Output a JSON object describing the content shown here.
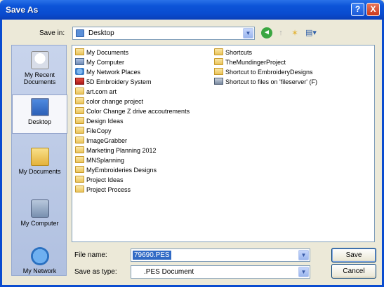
{
  "window": {
    "title": "Save As",
    "help_label": "?",
    "close_label": "X"
  },
  "toolbar": {
    "save_in_label": "Save in:",
    "save_in_value": "Desktop",
    "back_glyph": "◄",
    "up_glyph": "↑",
    "new_folder_glyph": "✶",
    "views_glyph": "▤▾",
    "dropdown_glyph": "▼"
  },
  "places": [
    {
      "label": "My Recent Documents",
      "icon": "recent-documents-icon"
    },
    {
      "label": "Desktop",
      "icon": "desktop-icon"
    },
    {
      "label": "My Documents",
      "icon": "my-documents-icon"
    },
    {
      "label": "My Computer",
      "icon": "my-computer-icon"
    },
    {
      "label": "My Network",
      "icon": "my-network-icon"
    }
  ],
  "files_col1": [
    {
      "label": "My Documents",
      "icon": "my-documents-icon"
    },
    {
      "label": "My Computer",
      "icon": "my-computer-icon"
    },
    {
      "label": "My Network Places",
      "icon": "network-icon"
    },
    {
      "label": "5D Embroidery System",
      "icon": "app-icon"
    },
    {
      "label": "art.com art",
      "icon": "folder-icon"
    },
    {
      "label": "color change project",
      "icon": "folder-icon"
    },
    {
      "label": "Color Change Z drive accoutrements",
      "icon": "folder-icon"
    },
    {
      "label": "Design Ideas",
      "icon": "folder-icon"
    },
    {
      "label": "FileCopy",
      "icon": "folder-icon"
    },
    {
      "label": "ImageGrabber",
      "icon": "folder-icon"
    },
    {
      "label": "Marketing Planning 2012",
      "icon": "folder-icon"
    },
    {
      "label": "MNSplanning",
      "icon": "folder-icon"
    },
    {
      "label": "MyEmbroideries Designs",
      "icon": "folder-icon"
    },
    {
      "label": "Project Ideas",
      "icon": "folder-icon"
    },
    {
      "label": "Project Process",
      "icon": "folder-icon"
    }
  ],
  "files_col2": [
    {
      "label": "Shortcuts",
      "icon": "folder-icon"
    },
    {
      "label": "TheMundingerProject",
      "icon": "folder-icon"
    },
    {
      "label": "Shortcut to EmbroideryDesigns",
      "icon": "shortcut-folder-icon"
    },
    {
      "label": "Shortcut to files on 'fileserver' (F)",
      "icon": "network-drive-icon"
    }
  ],
  "bottom": {
    "file_name_label": "File name:",
    "file_name_value": "79690.PES",
    "save_as_type_label": "Save as type:",
    "save_as_type_value": ".PES Document",
    "save_button": "Save",
    "cancel_button": "Cancel"
  },
  "colors": {
    "title_bar": "#0a4cd0",
    "selection": "#316ac5",
    "dialog_bg": "#ece9d8"
  }
}
